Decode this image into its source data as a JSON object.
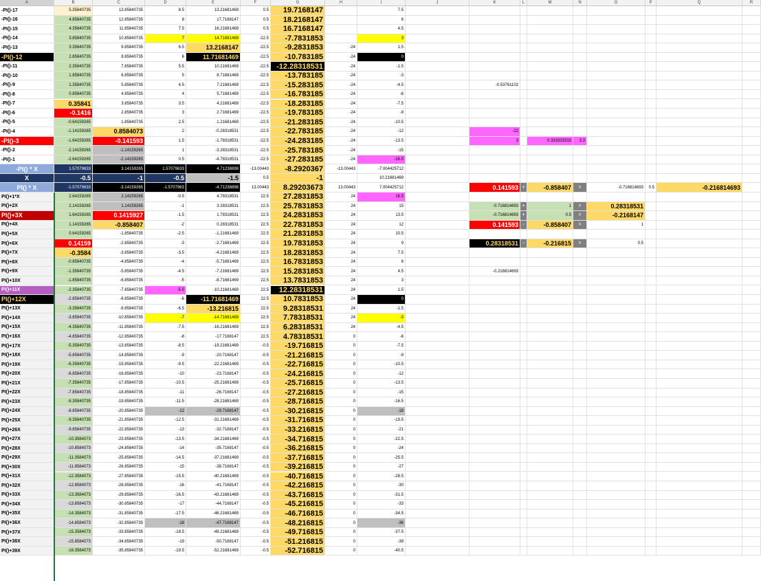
{
  "columns": [
    "A",
    "B",
    "C",
    "D",
    "E",
    "F",
    "G",
    "H",
    "I",
    "J",
    "K",
    "L",
    "M",
    "N",
    "O",
    "P",
    "Q",
    "R"
  ],
  "selected_column": "A",
  "colors": {
    "yellow": "#ffff00",
    "gold": "#ffd966",
    "green": "#c6e0b4",
    "red": "#ff0000",
    "black": "#000000",
    "pink": "#ff66ff",
    "grey": "#bfbfbf",
    "blue": "#8ea9db",
    "navy": "#203764",
    "purple": "#b45fc1",
    "darkred": "#c00000",
    "dkgrey": "#808080"
  },
  "rows": [
    [
      "-PI()-17",
      "5.35840735",
      "13.85840735",
      "8.5",
      "13.21681469",
      "0.5",
      "19.7168147",
      "",
      "7.5"
    ],
    [
      "-PI()-16",
      "4.85840735",
      "12.85840735",
      "8",
      "17.7168147",
      "0.5",
      "18.2168147",
      "",
      "6"
    ],
    [
      "-PI()-15",
      "4.35840735",
      "11.85840735",
      "7.5",
      "16.21681469",
      "0.5",
      "16.7168147",
      "",
      "4.5"
    ],
    [
      "-PI()-14",
      "3.85840735",
      "10.85840735",
      "7",
      "14.71681469",
      "-22.5",
      "-7.7831853",
      "",
      "3"
    ],
    [
      "-PI()-13",
      "3.35840735",
      "9.85840735",
      "6.5",
      "13.2168147",
      "-22.5",
      "-9.2831853",
      "-24",
      "1.5"
    ],
    [
      "-PI()-12",
      "2.85840735",
      "8.85840735",
      "6",
      "11.71681469",
      "-22.5",
      "-10.783185",
      "-24",
      "0"
    ],
    [
      "-PI()-11",
      "2.35840735",
      "7.85840735",
      "5.5",
      "10.21681469",
      "-22.5",
      "-12.28318531",
      "-24",
      "-1.5"
    ],
    [
      "-PI()-10",
      "1.85840735",
      "6.85840735",
      "5",
      "8.71681469",
      "-22.5",
      "-13.783185",
      "-24",
      "-3"
    ],
    [
      "-PI()-9",
      "1.35840735",
      "5.85840735",
      "4.5",
      "7.21681469",
      "-22.5",
      "-15.283185",
      "-24",
      "-4.5"
    ],
    [
      "-PI()-8",
      "0.85840735",
      "4.85840735",
      "4",
      "5.71681469",
      "-22.5",
      "-16.783185",
      "-24",
      "-6"
    ],
    [
      "-PI()-7",
      "0.35841",
      "3.85840735",
      "3.5",
      "4.21681469",
      "-22.5",
      "-18.283185",
      "-24",
      "-7.5"
    ],
    [
      "-PI()-6",
      "-0.1416",
      "2.85840735",
      "3",
      "2.71681469",
      "-22.5",
      "-19.783185",
      "-24",
      "-9"
    ],
    [
      "-PI()-5",
      "-0.64159265",
      "1.85840735",
      "2.5",
      "1.21681469",
      "-22.5",
      "-21.283185",
      "-24",
      "-10.5"
    ],
    [
      "-PI()-4",
      "-1.14159265",
      "0.8584073",
      "2",
      "-0.28318531",
      "-22.5",
      "-22.783185",
      "-24",
      "-12"
    ],
    [
      "-PI()-3",
      "-1.64159265",
      "-0.141593",
      "1.5",
      "-1.78318531",
      "-22.5",
      "-24.283185",
      "-24",
      "-13.5"
    ],
    [
      "-PI()-2",
      "-2.14159265",
      "-1.14159265",
      "1",
      "-3.28318531",
      "-22.5",
      "-25.783185",
      "-24",
      "-15"
    ],
    [
      "-PI()-1",
      "-2.64159265",
      "-2.14159265",
      "0.5",
      "-4.78318531",
      "-22.5",
      "-27.283185",
      "-24",
      "-16.5"
    ],
    [
      "-PI() * X",
      "1.57079633",
      "3.14159265",
      "1.57079633",
      "4.71238898",
      "-13.00443",
      "-8.2920367",
      "-13.00443",
      "-7.004425712"
    ],
    [
      "X",
      "-0.5",
      "-1",
      "-0.5",
      "-1.5",
      "0.5",
      "-1",
      "",
      "10.21681469"
    ],
    [
      "PI() * X",
      "-1.57079633",
      "-3.14159265",
      "-1.5707963",
      "-4.71238898",
      "13.00443",
      "8.29203673",
      "13.00443",
      "7.004425712"
    ],
    [
      "PI()+1*X",
      "2.64159265",
      "2.14159265",
      "-0.5",
      "4.78318531",
      "22.5",
      "27.2831853",
      "24",
      "16.5"
    ],
    [
      "PI()+2X",
      "2.14159265",
      "1.14159265",
      "-1",
      "3.28318531",
      "22.5",
      "25.7831853",
      "24",
      "15"
    ],
    [
      "PI()+3X",
      "1.64159265",
      "0.1415927",
      "-1.5",
      "1.78318531",
      "22.5",
      "24.2831853",
      "24",
      "13.5"
    ],
    [
      "PI()+4X",
      "1.14159265",
      "-0.858407",
      "-2",
      "0.28318531",
      "22.5",
      "22.7831853",
      "24",
      "12"
    ],
    [
      "PI()+5X",
      "0.64159265",
      "-1.85840735",
      "-2.5",
      "-1.21681469",
      "22.5",
      "21.2831853",
      "24",
      "10.5"
    ],
    [
      "PI()+6X",
      "0.14159",
      "-2.85840735",
      "-3",
      "-2.71681469",
      "22.5",
      "19.7831853",
      "24",
      "9"
    ],
    [
      "PI()+7X",
      "-0.3584",
      "-3.85840735",
      "-3.5",
      "-4.21681469",
      "22.5",
      "18.2831853",
      "24",
      "7.5"
    ],
    [
      "PI()+8X",
      "-0.85840735",
      "-4.85840735",
      "-4",
      "-5.71681469",
      "22.5",
      "16.7831853",
      "24",
      "6"
    ],
    [
      "PI()+9X",
      "-1.35840735",
      "-5.85840735",
      "-4.5",
      "-7.21681469",
      "22.5",
      "15.2831853",
      "24",
      "4.5"
    ],
    [
      "PI()+10X",
      "-1.85840735",
      "-6.85840735",
      "-5",
      "-8.71681469",
      "22.5",
      "13.7831853",
      "24",
      "3"
    ],
    [
      "PI()+11X",
      "-2.35840735",
      "-7.85840735",
      "-5.5",
      "-10.21681469",
      "22.5",
      "12.28318531",
      "24",
      "1.5"
    ],
    [
      "PI()+12X",
      "-2.85840735",
      "-8.85840735",
      "-6",
      "-11.71681469",
      "22.5",
      "10.7831853",
      "24",
      "0"
    ],
    [
      "PI()+13X",
      "-3.35840735",
      "-9.85840735",
      "-6.5",
      "-13.216815",
      "22.5",
      "9.28318531",
      "24",
      "-1.5"
    ],
    [
      "PI()+14X",
      "-3.85840735",
      "-10.85840735",
      "-7",
      "-14.71681469",
      "22.5",
      "7.78318531",
      "24",
      "-3"
    ],
    [
      "PI()+15X",
      "-4.35840735",
      "-11.85840735",
      "-7.5",
      "-16.21681469",
      "22.5",
      "6.28318531",
      "24",
      "-4.5"
    ],
    [
      "PI()+16X",
      "-4.85840735",
      "-12.85840735",
      "-8",
      "-17.7168147",
      "22.5",
      "4.78318531",
      "0",
      "-6"
    ],
    [
      "PI()+17X",
      "-5.35840735",
      "-13.85840735",
      "-8.5",
      "-19.21681469",
      "-0.5",
      "-19.716815",
      "0",
      "-7.5"
    ],
    [
      "PI()+18X",
      "-5.85840735",
      "-14.85840735",
      "-9",
      "-20.7168147",
      "-0.5",
      "-21.216815",
      "0",
      "-9"
    ],
    [
      "PI()+19X",
      "-6.35840735",
      "-15.85840735",
      "-9.5",
      "-22.21681469",
      "-0.5",
      "-22.716815",
      "0",
      "-10.5"
    ],
    [
      "PI()+20X",
      "-6.85840735",
      "-16.85840735",
      "-10",
      "-23.7168147",
      "-0.5",
      "-24.216815",
      "0",
      "-12"
    ],
    [
      "PI()+21X",
      "-7.35840735",
      "-17.85840735",
      "-10.5",
      "-25.21681469",
      "-0.5",
      "-25.716815",
      "0",
      "-13.5"
    ],
    [
      "PI()+22X",
      "-7.85840735",
      "-18.85840735",
      "-11",
      "-26.7168147",
      "-0.5",
      "-27.216815",
      "0",
      "-15"
    ],
    [
      "PI()+23X",
      "-8.35840735",
      "-19.85840735",
      "-11.5",
      "-28.21681469",
      "-0.5",
      "-28.716815",
      "0",
      "-16.5"
    ],
    [
      "PI()+24X",
      "-8.85840735",
      "-20.85840735",
      "-12",
      "-29.7168147",
      "-0.5",
      "-30.216815",
      "0",
      "-18"
    ],
    [
      "PI()+25X",
      "-9.35840735",
      "-21.85840735",
      "-12.5",
      "-31.21681469",
      "-0.5",
      "-31.716815",
      "0",
      "-19.5"
    ],
    [
      "PI()+26X",
      "-9.85840735",
      "-22.85840735",
      "-13",
      "-32.7168147",
      "-0.5",
      "-33.216815",
      "0",
      "-21"
    ],
    [
      "PI()+27X",
      "-10.3584073",
      "-23.85840735",
      "-13.5",
      "-34.21681469",
      "-0.5",
      "-34.716815",
      "0",
      "-22.5"
    ],
    [
      "PI()+28X",
      "-10.8584073",
      "-24.85840735",
      "-14",
      "-35.7168147",
      "-0.5",
      "-36.216815",
      "0",
      "-24"
    ],
    [
      "PI()+29X",
      "-11.3584073",
      "-25.85840735",
      "-14.5",
      "-37.21681469",
      "-0.5",
      "-37.716815",
      "0",
      "-25.5"
    ],
    [
      "PI()+30X",
      "-11.8584073",
      "-26.85840735",
      "-15",
      "-38.7168147",
      "-0.5",
      "-39.216815",
      "0",
      "-27"
    ],
    [
      "PI()+31X",
      "-12.3584073",
      "-27.85840735",
      "-15.5",
      "-40.21681469",
      "-0.5",
      "-40.716815",
      "0",
      "-28.5"
    ],
    [
      "PI()+32X",
      "-12.8584073",
      "-28.85840735",
      "-16",
      "-41.7168147",
      "-0.5",
      "-42.216815",
      "0",
      "-30"
    ],
    [
      "PI()+33X",
      "-13.3584073",
      "-29.85840735",
      "-16.5",
      "-43.21681469",
      "-0.5",
      "-43.716815",
      "0",
      "-31.5"
    ],
    [
      "PI()+34X",
      "-13.8584073",
      "-30.85840735",
      "-17",
      "-44.7168147",
      "-0.5",
      "-45.216815",
      "0",
      "-33"
    ],
    [
      "PI()+35X",
      "-14.3584073",
      "-31.85840735",
      "-17.5",
      "-46.21681469",
      "-0.5",
      "-46.716815",
      "0",
      "-34.5"
    ],
    [
      "PI()+36X",
      "-14.8584073",
      "-32.85840735",
      "-18",
      "-47.7168147",
      "-0.5",
      "-48.216815",
      "0",
      "-36"
    ],
    [
      "PI()+37X",
      "-15.3584073",
      "-33.85840735",
      "-18.5",
      "-49.21681469",
      "-0.5",
      "-49.716815",
      "0",
      "-37.5"
    ],
    [
      "PI()+38X",
      "-15.8584073",
      "-34.85840735",
      "-19",
      "-50.7168147",
      "-0.5",
      "-51.216815",
      "0",
      "-39"
    ],
    [
      "PI()+39X",
      "-16.3584073",
      "-35.85840735",
      "-19.5",
      "-52.21681469",
      "-0.5",
      "-52.716815",
      "0",
      "-40.5"
    ]
  ],
  "side": {
    "k_val": "-0.53761102",
    "k_pink_1": "-22",
    "k_pink_2": "3",
    "m_pink": "0.333333333",
    "n_pink": "3.3",
    "row20": [
      "0.141593",
      "+",
      "-0.858407",
      "=",
      "-0.716814693",
      "0.5",
      "-0.216814693"
    ],
    "row22": [
      "-0.716814693",
      "+",
      "1",
      "=",
      "0.28318531"
    ],
    "row23": [
      "-0.716814693",
      "+",
      "0.5",
      "=",
      "-0.2168147"
    ],
    "row24": [
      "0.141593",
      "-",
      "-0.858407",
      "=",
      "1"
    ],
    "row26": [
      "0.28318531",
      "-",
      "-0.216815",
      "=",
      "0.5"
    ],
    "k_bottom": "-0.216814693"
  }
}
